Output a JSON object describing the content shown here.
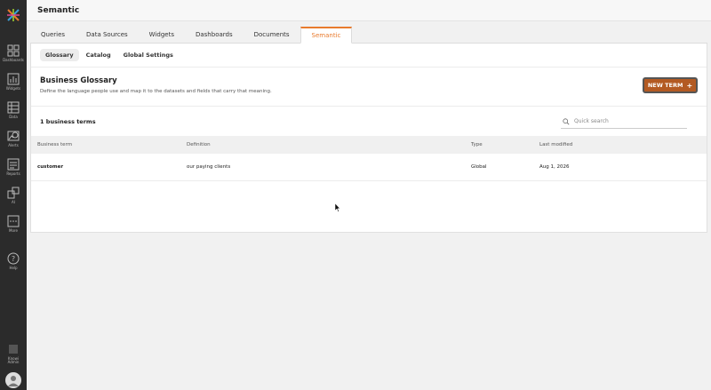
{
  "app": {
    "title": "Semantic"
  },
  "sidebar": {
    "items": [
      {
        "label": "Dashboards",
        "icon": "dashboards-icon"
      },
      {
        "label": "Widgets",
        "icon": "widgets-icon"
      },
      {
        "label": "Data",
        "icon": "data-icon"
      },
      {
        "label": "Alerts",
        "icon": "alerts-icon"
      },
      {
        "label": "Reports",
        "icon": "reports-icon"
      },
      {
        "label": "AI",
        "icon": "ai-icon"
      },
      {
        "label": "More",
        "icon": "more-icon"
      },
      {
        "label": "Help",
        "icon": "help-icon"
      }
    ],
    "user": {
      "label_line1": "Knowi",
      "label_line2": "Admin"
    }
  },
  "tabs": [
    "Queries",
    "Data Sources",
    "Widgets",
    "Dashboards",
    "Documents",
    "Semantic"
  ],
  "active_tab": "Semantic",
  "subtabs": [
    "Glossary",
    "Catalog",
    "Global Settings"
  ],
  "glossary": {
    "title": "Business Glossary",
    "description": "Define the language people use and map it to the datasets and fields that carry that meaning.",
    "new_term_label": "NEW TERM",
    "count_label": "1 business terms",
    "search_placeholder": "Quick search"
  },
  "table": {
    "headers": {
      "term": "Business term",
      "definition": "Definition",
      "type": "Type",
      "modified": "Last modified"
    },
    "rows": [
      {
        "term": "customer",
        "definition": "our paying clients",
        "type": "Global",
        "modified": "Aug 1, 2026"
      }
    ]
  },
  "colors": {
    "accent": "#e87a2c",
    "button": "#b35a22",
    "sidebar": "#2b2b2b"
  }
}
